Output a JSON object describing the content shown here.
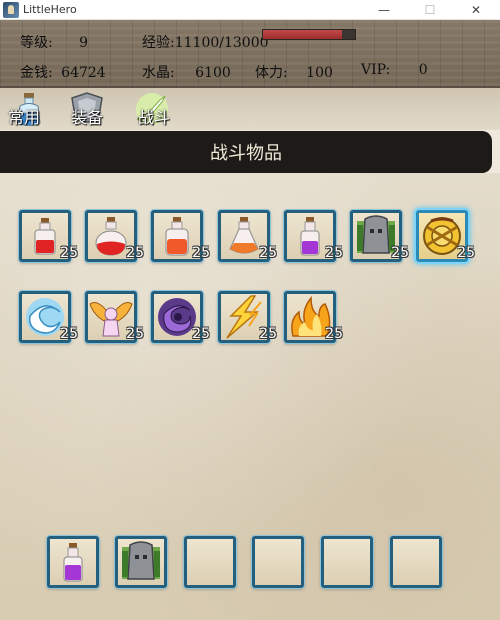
{
  "window": {
    "title": "LittleHero",
    "minimize": "—",
    "maximize": "☐",
    "close": "✕"
  },
  "stats": {
    "level_label": "等级:",
    "level": "9",
    "exp_label": "经验:",
    "exp": "11100/13000",
    "exp_progress": 0.854,
    "gold_label": "金钱:",
    "gold": "64724",
    "crystal_label": "水晶:",
    "crystal": "6100",
    "stamina_label": "体力:",
    "stamina": "100",
    "vip_label": "VIP:",
    "vip": "0"
  },
  "tabs": [
    {
      "label": "常用",
      "icon": "potion-icon"
    },
    {
      "label": "装备",
      "icon": "armor-icon"
    },
    {
      "label": "战斗",
      "icon": "sword-icon"
    }
  ],
  "section_title": "战斗物品",
  "items": [
    {
      "icon": "red-potion-small-icon",
      "count": "25"
    },
    {
      "icon": "red-potion-large-icon",
      "count": "25"
    },
    {
      "icon": "orange-red-potion-icon",
      "count": "25"
    },
    {
      "icon": "orange-potion-icon",
      "count": "25"
    },
    {
      "icon": "purple-potion-icon",
      "count": "25"
    },
    {
      "icon": "stone-armor-icon",
      "count": "25"
    },
    {
      "icon": "golden-shield-icon",
      "count": "25",
      "selected": true
    },
    {
      "icon": "water-spell-icon",
      "count": "25"
    },
    {
      "icon": "angel-wings-icon",
      "count": "25"
    },
    {
      "icon": "purple-vortex-icon",
      "count": "25"
    },
    {
      "icon": "lightning-icon",
      "count": "25"
    },
    {
      "icon": "fire-icon",
      "count": "25"
    }
  ],
  "quickbar": [
    {
      "icon": "purple-potion-icon"
    },
    {
      "icon": "stone-armor-icon"
    },
    {
      "icon": "empty-slot"
    },
    {
      "icon": "empty-slot"
    },
    {
      "icon": "empty-slot"
    },
    {
      "icon": "empty-slot"
    }
  ]
}
